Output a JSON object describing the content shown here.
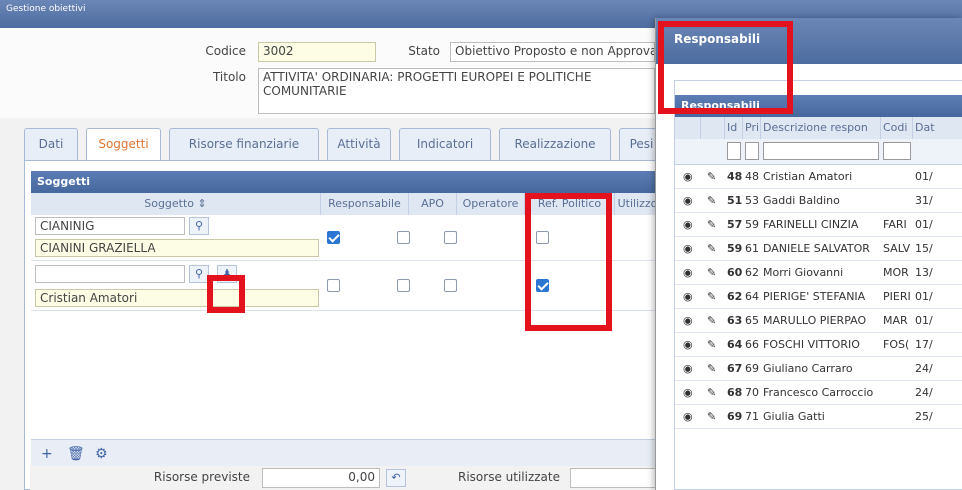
{
  "window": {
    "title": "Gestione obiettivi"
  },
  "form": {
    "codice_label": "Codice",
    "codice_value": "3002",
    "stato_label": "Stato",
    "stato_value": "Obiettivo Proposto e non Approvato",
    "titolo_label": "Titolo",
    "titolo_value": "ATTIVITA' ORDINARIA: PROGETTI EUROPEI E POLITICHE COMUNITARIE"
  },
  "tabs": [
    "Dati",
    "Soggetti",
    "Risorse finanziarie",
    "Attività",
    "Indicatori",
    "Realizzazione",
    "Pesi"
  ],
  "soggetti": {
    "header": "Soggetti",
    "columns": [
      "Soggetto",
      "Responsabile",
      "APO",
      "Operatore",
      "Ref. Politico",
      "Utilizzo"
    ],
    "rows": [
      {
        "code": "CIANINIG",
        "name": "CIANINI GRAZIELLA",
        "responsabile": true,
        "apo": false,
        "operatore": false,
        "ref_politico": false
      },
      {
        "code": "",
        "name": "Cristian Amatori",
        "responsabile": false,
        "apo": false,
        "operatore": false,
        "ref_politico": true
      }
    ],
    "footer_icons": [
      "plus-icon",
      "trash-icon",
      "gear-icon"
    ]
  },
  "bottom": {
    "risorse_previste_label": "Risorse previste",
    "risorse_previste_value": "0,00",
    "risorse_utilizzate_label": "Risorse utilizzate"
  },
  "modal": {
    "title": "Responsabili",
    "inner_title": "Responsabili",
    "columns": [
      "Id",
      "Pri",
      "Descrizione respon",
      "Codi",
      "Dat"
    ],
    "rows": [
      {
        "id": "48",
        "pri": "48",
        "desc": "Cristian Amatori",
        "cod": "",
        "dat": "01/"
      },
      {
        "id": "51",
        "pri": "53",
        "desc": "Gaddi Baldino",
        "cod": "",
        "dat": "31/"
      },
      {
        "id": "57",
        "pri": "59",
        "desc": "FARINELLI CINZIA",
        "cod": "FARI",
        "dat": "01/"
      },
      {
        "id": "59",
        "pri": "61",
        "desc": "DANIELE SALVATOR",
        "cod": "SALV",
        "dat": "15/"
      },
      {
        "id": "60",
        "pri": "62",
        "desc": "Morri Giovanni",
        "cod": "MOR",
        "dat": "13/"
      },
      {
        "id": "62",
        "pri": "64",
        "desc": "PIERIGE' STEFANIA",
        "cod": "PIERI",
        "dat": "01/"
      },
      {
        "id": "63",
        "pri": "65",
        "desc": "MARULLO PIERPAO",
        "cod": "MAR",
        "dat": "01/"
      },
      {
        "id": "64",
        "pri": "66",
        "desc": "FOSCHI VITTORIO",
        "cod": "FOS(",
        "dat": "17/"
      },
      {
        "id": "67",
        "pri": "69",
        "desc": "Giuliano Carraro",
        "cod": "",
        "dat": "24/"
      },
      {
        "id": "68",
        "pri": "70",
        "desc": "Francesco Carroccio",
        "cod": "",
        "dat": "24/"
      },
      {
        "id": "69",
        "pri": "71",
        "desc": "Giulia Gatti",
        "cod": "",
        "dat": "25/"
      }
    ]
  },
  "colors": {
    "header_blue": "#4d6c9f",
    "active_tab": "#e0752f",
    "highlight": "#e4121d",
    "checkbox_on": "#2a76d2"
  }
}
